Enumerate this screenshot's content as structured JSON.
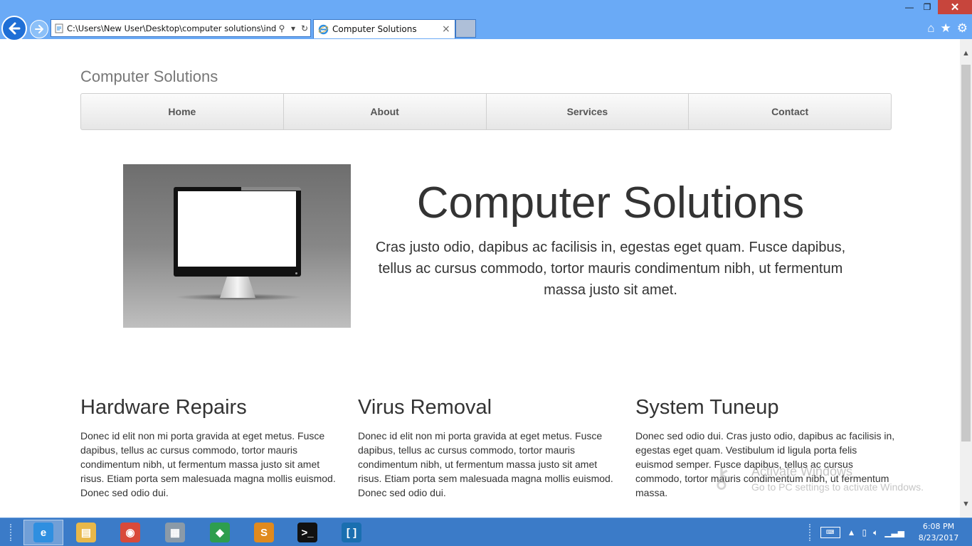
{
  "browser": {
    "address_url": "C:\\Users\\New User\\Desktop\\computer solutions\\inde:",
    "tab_title": "Computer Solutions",
    "tab_close": "×",
    "window_controls": {
      "minimize": "—",
      "restore": "❐",
      "close": "✕"
    },
    "icons": [
      "back-arrow-icon",
      "forward-arrow-icon",
      "ie-icon",
      "search-icon",
      "dropdown-icon",
      "refresh-icon",
      "home-icon",
      "favorites-star-icon",
      "gear-icon"
    ]
  },
  "site": {
    "brand": "Computer Solutions",
    "nav": [
      {
        "label": "Home"
      },
      {
        "label": "About"
      },
      {
        "label": "Services"
      },
      {
        "label": "Contact"
      }
    ],
    "hero": {
      "title": "Computer Solutions",
      "text": "Cras justo odio, dapibus ac facilisis in, egestas eget quam. Fusce dapibus, tellus ac cursus commodo, tortor mauris condimentum nibh, ut fermentum massa justo sit amet."
    },
    "columns": [
      {
        "heading": "Hardware Repairs",
        "body": "Donec id elit non mi porta gravida at eget metus. Fusce dapibus, tellus ac cursus commodo, tortor mauris condimentum nibh, ut fermentum massa justo sit amet risus. Etiam porta sem malesuada magna mollis euismod. Donec sed odio dui."
      },
      {
        "heading": "Virus Removal",
        "body": "Donec id elit non mi porta gravida at eget metus. Fusce dapibus, tellus ac cursus commodo, tortor mauris condimentum nibh, ut fermentum massa justo sit amet risus. Etiam porta sem malesuada magna mollis euismod. Donec sed odio dui."
      },
      {
        "heading": "System Tuneup",
        "body": "Donec sed odio dui. Cras justo odio, dapibus ac facilisis in, egestas eget quam. Vestibulum id ligula porta felis euismod semper. Fusce dapibus, tellus ac cursus commodo, tortor mauris condimentum nibh, ut fermentum massa."
      }
    ]
  },
  "watermark": {
    "title": "Activate Windows",
    "subtitle": "Go to PC settings to activate Windows."
  },
  "taskbar": {
    "apps": [
      {
        "name": "internet-explorer",
        "glyph": "e",
        "color": "#2f8fe0",
        "active": true
      },
      {
        "name": "file-explorer",
        "glyph": "▤",
        "color": "#e8b84a",
        "active": false
      },
      {
        "name": "chrome",
        "glyph": "◉",
        "color": "#d94a3a",
        "active": false
      },
      {
        "name": "control-panel",
        "glyph": "▦",
        "color": "#8a9aa8",
        "active": false
      },
      {
        "name": "git",
        "glyph": "◆",
        "color": "#2e9e4e",
        "active": false
      },
      {
        "name": "sublime-text",
        "glyph": "S",
        "color": "#e08a1e",
        "active": false
      },
      {
        "name": "command-prompt",
        "glyph": ">_",
        "color": "#111111",
        "active": false
      },
      {
        "name": "brackets",
        "glyph": "[ ]",
        "color": "#1a6fb0",
        "active": false
      }
    ],
    "time": "6:08 PM",
    "date": "8/23/2017"
  }
}
